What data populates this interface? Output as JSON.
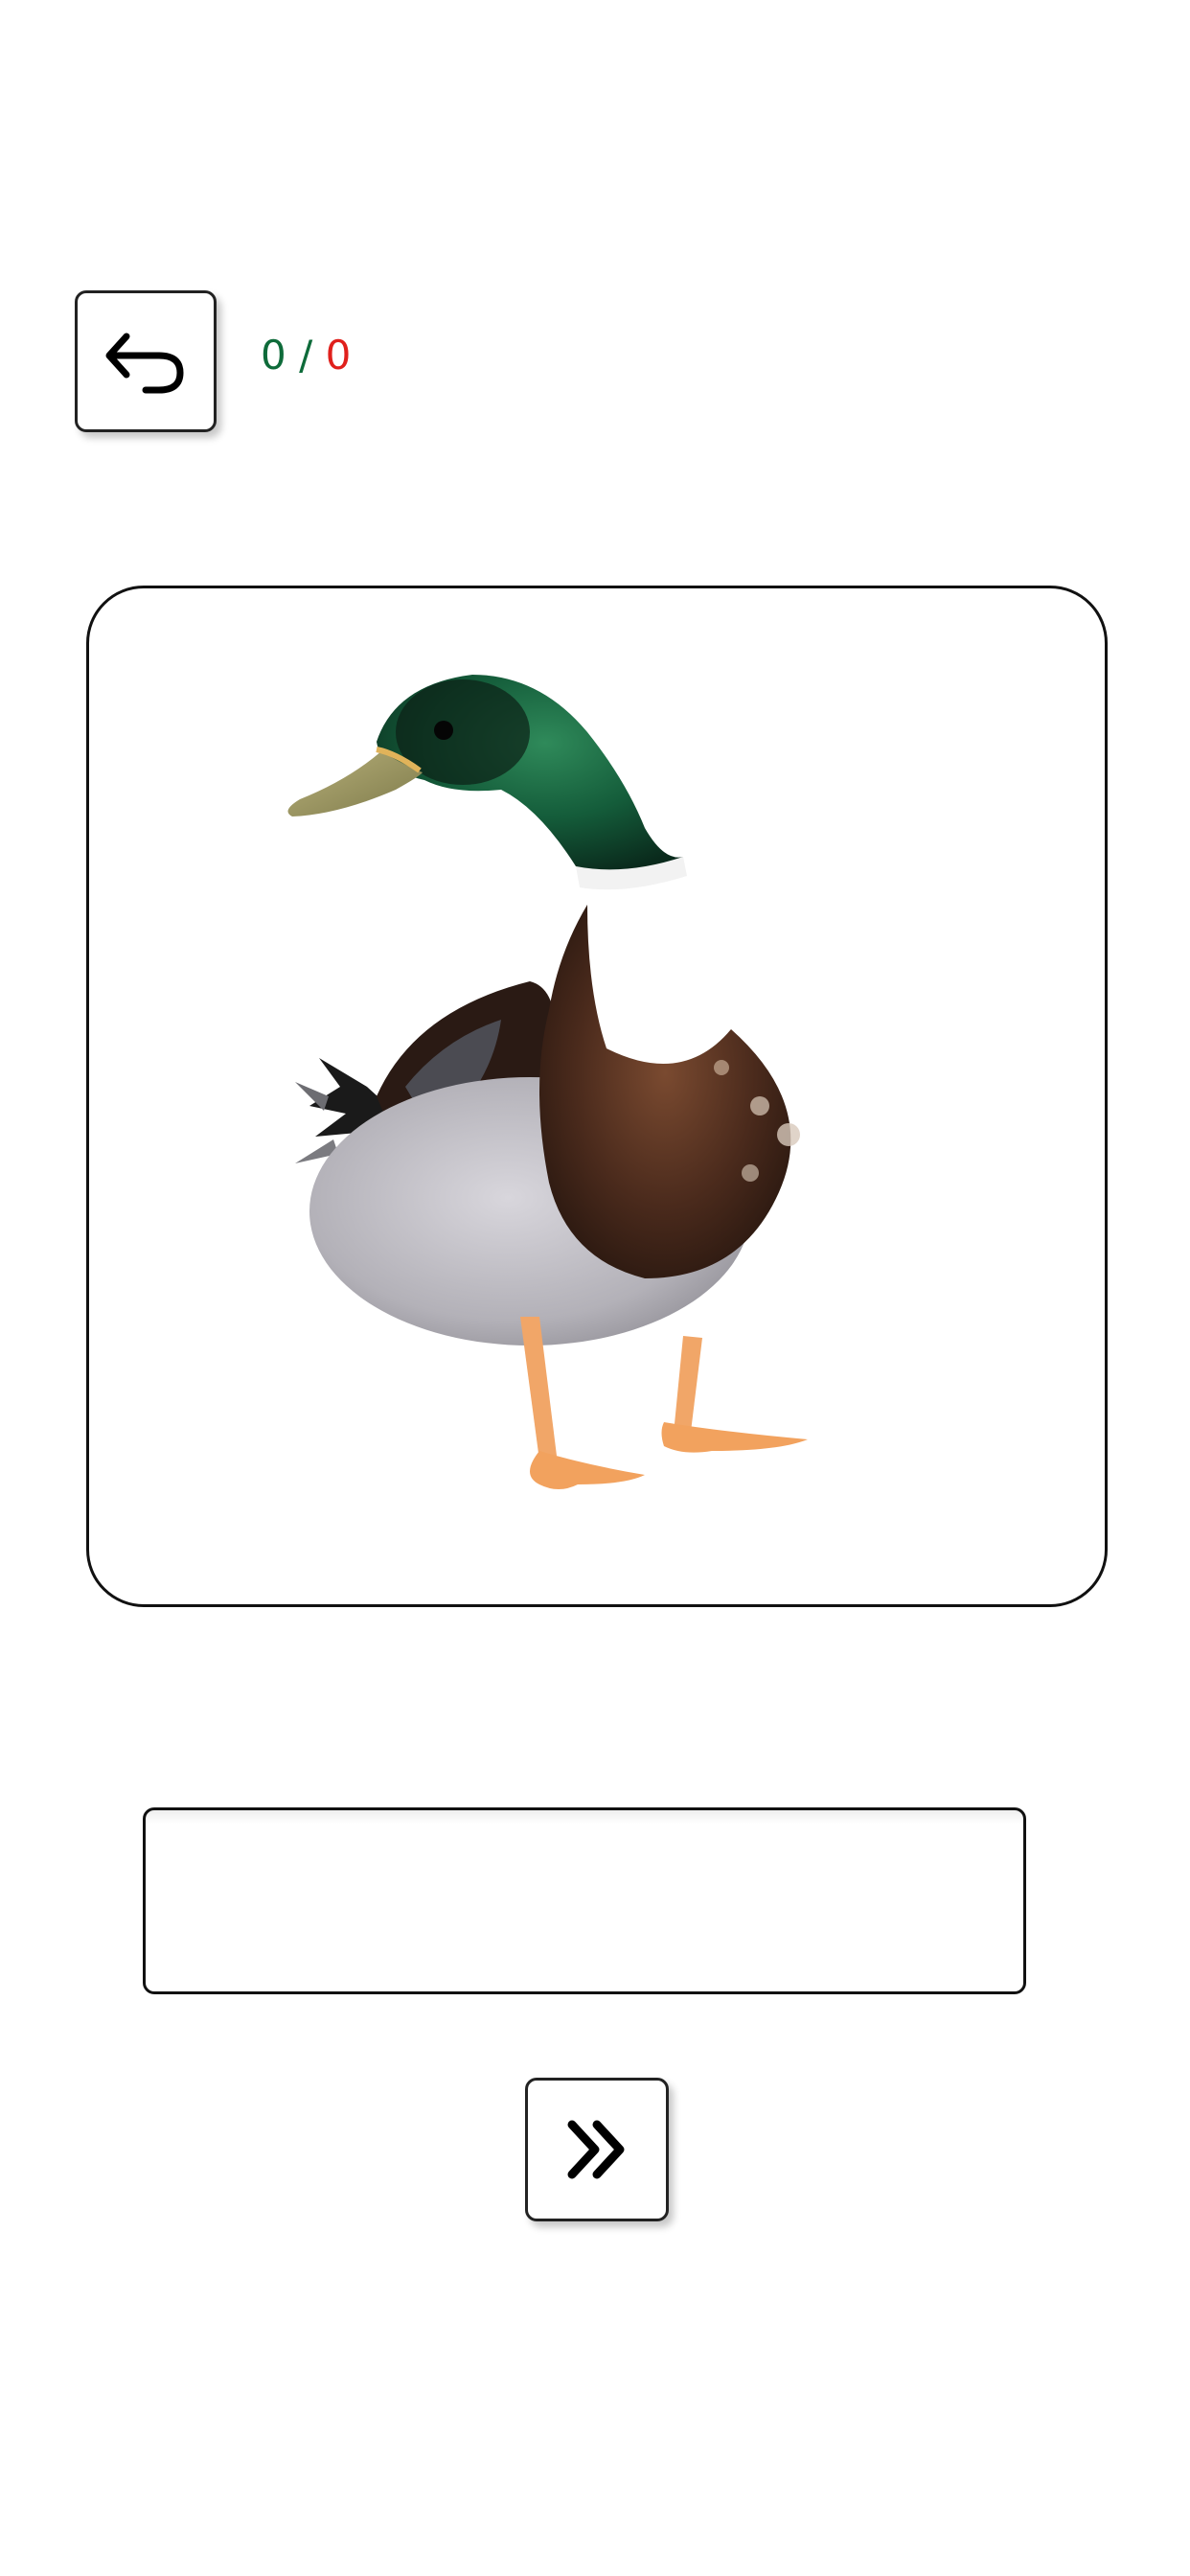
{
  "header": {
    "back_icon": "undo-arrow-icon",
    "score": {
      "correct": "0",
      "separator": "/",
      "wrong": "0"
    }
  },
  "image": {
    "subject_icon": "mallard-duck-image"
  },
  "answer": {
    "value": "",
    "placeholder": ""
  },
  "footer": {
    "next_icon": "double-chevron-right-icon"
  },
  "colors": {
    "correct": "#0e6b3a",
    "wrong": "#e0201c",
    "border": "#111111"
  }
}
